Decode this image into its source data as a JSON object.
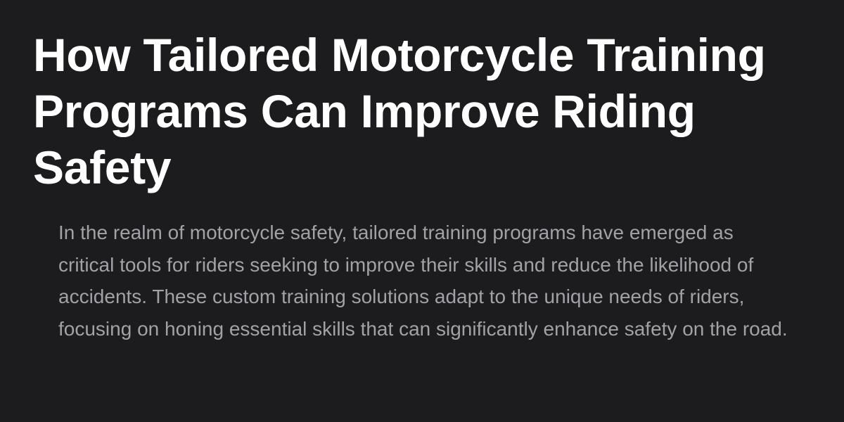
{
  "article": {
    "title": "How Tailored Motorcycle Training Programs Can Improve Riding Safety",
    "summary": "In the realm of motorcycle safety, tailored training programs have emerged as critical tools for riders seeking to improve their skills and reduce the likelihood of accidents. These custom training solutions adapt to the unique needs of riders, focusing on honing essential skills that can significantly enhance safety on the road."
  },
  "colors": {
    "background": "#1c1c1e",
    "title": "#ffffff",
    "summary": "#a1a1a6"
  }
}
